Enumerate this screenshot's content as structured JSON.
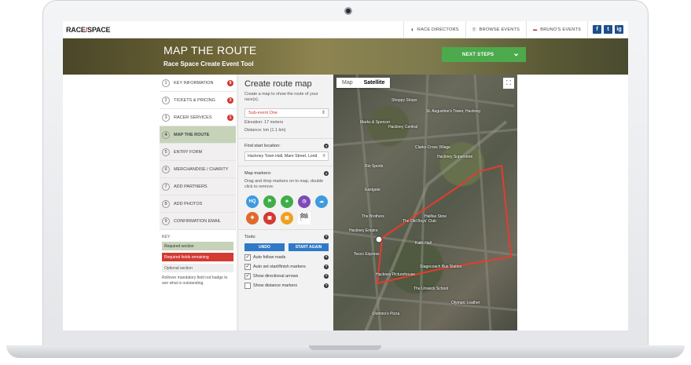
{
  "topbar": {
    "logo_left": "RACE",
    "logo_right": "SPACE",
    "nav": [
      {
        "label": "RACE DIRECTORS",
        "icon": "headset-icon"
      },
      {
        "label": "BROWSE EVENTS",
        "icon": "map-pin-icon"
      },
      {
        "label": "BRUNO'S EVENTS",
        "icon": "user-badge-icon"
      }
    ],
    "social": [
      "f",
      "t",
      "ig"
    ]
  },
  "hero": {
    "title": "MAP THE ROUTE",
    "subtitle": "Race Space Create Event Tool",
    "next_label": "NEXT STEPS"
  },
  "steps": [
    {
      "num": "1",
      "label": "KEY INFORMATION",
      "alert": "9"
    },
    {
      "num": "2",
      "label": "TICKETS & PRICING",
      "alert": "3"
    },
    {
      "num": "3",
      "label": "RACER SERVICES",
      "alert": "1"
    },
    {
      "num": "4",
      "label": "MAP THE ROUTE",
      "alert": ""
    },
    {
      "num": "5",
      "label": "ENTRY FORM",
      "alert": ""
    },
    {
      "num": "6",
      "label": "MERCHANDISE / CHARITY",
      "alert": ""
    },
    {
      "num": "7",
      "label": "ADD PARTNERS",
      "alert": ""
    },
    {
      "num": "8",
      "label": "ADD PHOTOS",
      "alert": ""
    },
    {
      "num": "9",
      "label": "CONFIRMATION EMAIL",
      "alert": ""
    }
  ],
  "key": {
    "title": "KEY:",
    "required": "Required section",
    "remaining": "Required fields remaining",
    "optional": "Optional section",
    "note": "Rollover mandatory field red badge to see what is outstanding."
  },
  "panel": {
    "title": "Create route map",
    "hint": "Create a map to show the route of your race(s).",
    "select_value": "Sub-event One",
    "elevation": "Elevation: 17 meters",
    "distance": "Distance: km (1.1 km)",
    "start_label": "Find start location:",
    "start_value": "Hackney Town Hall, Mare Street, Lond",
    "markers_label": "Map markers:",
    "markers_hint": "Drag and drop markers on to map, double click to remove.",
    "markers": [
      {
        "name": "hq-marker-icon",
        "text": "HQ",
        "color": "#3d9be0"
      },
      {
        "name": "flag-marker-icon",
        "text": "⚑",
        "color": "#3fae4a"
      },
      {
        "name": "tree-marker-icon",
        "text": "♣",
        "color": "#3fae4a"
      },
      {
        "name": "timer-marker-icon",
        "text": "◷",
        "color": "#7d4ab8"
      },
      {
        "name": "cloud-marker-icon",
        "text": "☁",
        "color": "#3d9be0"
      },
      {
        "name": "medical-marker-icon",
        "text": "✚",
        "color": "#e06a2c"
      },
      {
        "name": "car-marker-icon",
        "text": "▣",
        "color": "#d23a32"
      },
      {
        "name": "water-marker-icon",
        "text": "▤",
        "color": "#f0a020"
      },
      {
        "name": "finish-flag-icon",
        "text": "🏁",
        "color": "#ffffff"
      }
    ],
    "tools_label": "Tools:",
    "undo_label": "UNDO",
    "start_again_label": "START AGAIN",
    "options": [
      {
        "label": "Auto follow roads",
        "checked": true
      },
      {
        "label": "Auto set start/finish markers",
        "checked": true
      },
      {
        "label": "Show directional arrows",
        "checked": true
      },
      {
        "label": "Show distance markers",
        "checked": false
      }
    ]
  },
  "map": {
    "tab_map": "Map",
    "tab_satellite": "Satellite",
    "labels": [
      "Shoppy Shops",
      "St. Augustine's Tower, Hackney",
      "Marks & Spencer",
      "Hackney Central",
      "Clarks Cross Village",
      "Hackney Superstore",
      "Rio Sports",
      "Eastgate",
      "The Brothers",
      "The Old Boys' Club",
      "Stagecoach Bus Station",
      "Olympic Leather",
      "Domino's Pizza",
      "The Urswick School",
      "Halifax Stow",
      "Tesco Express",
      "Hackney Empire",
      "Kalik Hall",
      "Hackney Picturehouse"
    ]
  }
}
